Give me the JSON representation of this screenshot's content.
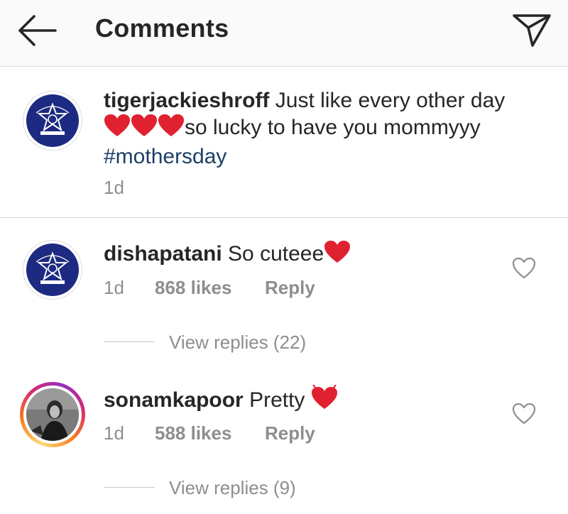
{
  "header": {
    "title": "Comments",
    "back_icon": "arrow-left-icon",
    "send_icon": "direct-send-icon"
  },
  "caption": {
    "username": "tigerjackieshroff",
    "text_line1": "Just like every other day",
    "text_line2": "so lucky to have you mommyyy",
    "hashtag": "#mothersday",
    "time": "1d"
  },
  "comments": [
    {
      "username": "dishapatani",
      "text": "So cuteee",
      "time": "1d",
      "likes": "868 likes",
      "reply_label": "Reply",
      "view_replies": "View replies (22)"
    },
    {
      "username": "sonamkapoor",
      "text": "Pretty",
      "time": "1d",
      "likes": "588 likes",
      "reply_label": "Reply",
      "view_replies": "View replies (9)"
    }
  ],
  "colors": {
    "heart": "#e0212f",
    "hashtag": "#1e3e66",
    "secondary_text": "#8e8e8e",
    "police_badge": "#1d2a82"
  }
}
